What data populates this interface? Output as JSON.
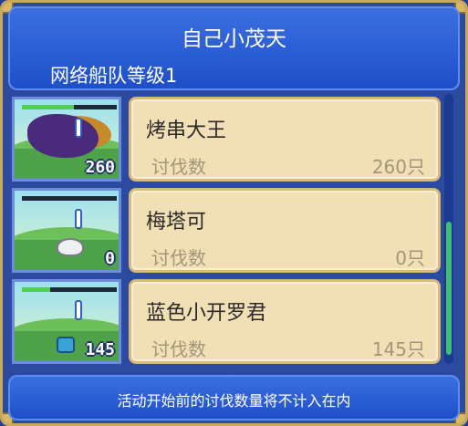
{
  "header": {
    "title": "自己小茂天",
    "subtitle": "网络船队等级1"
  },
  "rows": [
    {
      "name": "烤串大王",
      "label": "讨伐数",
      "value": "260只",
      "count": "260",
      "hp_fill": 0.55,
      "hp_color": "#4fd14f"
    },
    {
      "name": "梅塔可",
      "label": "讨伐数",
      "value": "0只",
      "count": "0",
      "hp_fill": 0.0,
      "hp_color": "#4fd14f"
    },
    {
      "name": "蓝色小开罗君",
      "label": "讨伐数",
      "value": "145只",
      "count": "145",
      "hp_fill": 0.3,
      "hp_color": "#4fd14f"
    }
  ],
  "footer": {
    "note": "活动开始前的讨伐数量将不计入在内"
  },
  "colors": {
    "frame_gold": "#c9a95c",
    "panel_blue": "#2b4aa0",
    "card_cream": "#f1dfb6"
  }
}
